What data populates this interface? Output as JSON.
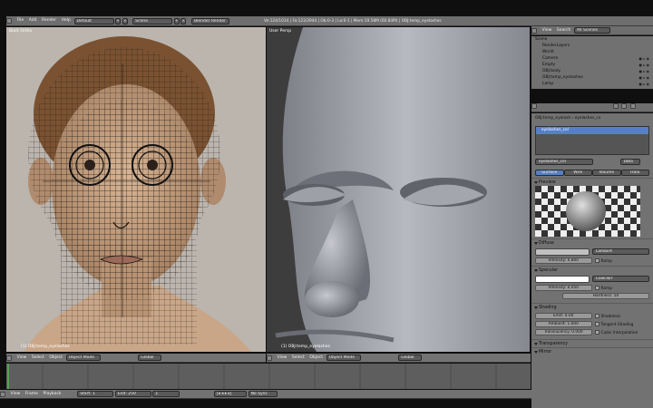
{
  "topbar": {
    "menus": [
      "File",
      "Add",
      "Render",
      "Help"
    ],
    "layout": "Default",
    "scene": "Scene",
    "engine": "Blender Render",
    "stats": "Ve:124/1014 | Fa:123/3944 | Ob:0-3 | La:0-1 | Mem:19.58M (60.84M) | OBJ:temp_eyelashes"
  },
  "viewport_left": {
    "label": "Back Ortho",
    "footer": "(1) OBJ:temp_eyelashes"
  },
  "viewport_right": {
    "label": "User Persp",
    "footer": "(1) OBJ:temp_eyelashes"
  },
  "viewport_header": {
    "menus": [
      "View",
      "Select",
      "Object"
    ],
    "mode": "Object Mode",
    "orientation": "Global"
  },
  "outliner": {
    "menus": [
      "View",
      "Search"
    ],
    "scenes": "All Scenes",
    "items": [
      "Scene",
      "RenderLayers",
      "World",
      "Camera",
      "Empty",
      "OBJ:body",
      "OBJ:temp_eyelashes",
      "Lamp"
    ]
  },
  "properties": {
    "breadcrumb": [
      "OBJ:temp_eyelash",
      "eyelashes_co"
    ],
    "material_slot": "eyelashes_col",
    "material_name": "eyelashes_col",
    "data_label": "Data",
    "tabs": [
      "Surface",
      "Wire",
      "Volume",
      "Halo"
    ],
    "preview": "Preview",
    "diffuse": {
      "title": "Diffuse",
      "shader": "Lambert",
      "intensity": "Intensity: 0.800",
      "ramp": "Ramp"
    },
    "specular": {
      "title": "Specular",
      "shader": "CookTorr",
      "intensity": "Intensity: 0.050",
      "ramp": "Ramp",
      "hardness": "Hardness: 50"
    },
    "shading": {
      "title": "Shading",
      "emit": "Emit: 0.00",
      "ambient": "Ambient: 1.000",
      "translucency": "Translucency: 0.000",
      "shadeless": "Shadeless",
      "tangent": "Tangent Shading",
      "cubic": "Cubic Interpolation"
    },
    "transparency": "Transparency",
    "mirror": "Mirror"
  },
  "timeline": {
    "menus": [
      "View",
      "Frame",
      "Playback"
    ],
    "start": "Start: 1",
    "end": "End: 250",
    "current": "1",
    "sync": "No Sync"
  }
}
